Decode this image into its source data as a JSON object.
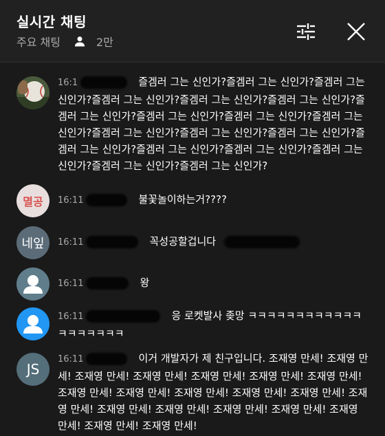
{
  "header": {
    "title": "실시간 채팅",
    "mode": "주요 채팅",
    "viewer_count": "2만"
  },
  "icons": {
    "viewer": "person-icon",
    "filter": "sliders-icon",
    "close": "close-icon"
  },
  "colors": {
    "header_bg": "#212121",
    "chat_bg": "#1a1a1a",
    "secondary_text": "#aaaaaa",
    "avatar_blue": "#2196f3",
    "avatar_gray": "#607d8b"
  },
  "messages": [
    {
      "time": "16:1",
      "avatar_text": "",
      "text": "즐겜러 그는 신인가?즐겜러 그는 신인가?즐겜러 그는 신인가?즐겜러 그는 신인가?즐겜러 그는 신인가?즐겜러 그는 신인가?즐겜러 그는 신인가?즐겜러 그는 신인가?즐겜러 그는 신인가?즐겜러 그는 신인가?즐겜러 그는 신인가?즐겜러 그는 신인가?즐겜러 그는 신인가?즐겜러 그는 신인가?즐겜러 그는 신인가?즐겜러 그는 신인가?즐겜러 그는 신인가?즐겜러 그는 신인가?즐겜러 그는 신인가?"
    },
    {
      "time": "16:11",
      "avatar_text": "멸공",
      "text": "불꽃놀이하는거????"
    },
    {
      "time": "16:11",
      "avatar_text": "네잎",
      "text": "꼭성공할겁니다"
    },
    {
      "time": "16:11",
      "avatar_text": "",
      "text": "왕"
    },
    {
      "time": "16:11",
      "avatar_text": "",
      "text": "응 로켓발사 좆망 ㅋㅋㅋㅋㅋㅋㅋㅋㅋㅋㅋㅋㅋㅋㅋㅋㅋㅋㅋ"
    },
    {
      "time": "16:11",
      "avatar_text": "JS",
      "text": "이거 개발자가 제 친구입니다. 조재영 만세! 조재영 만세! 조재영 만세! 조재영 만세! 조재영 만세! 조재영 만세! 조재영 만세! 조재영 만세! 조재영 만세! 조재영 만세! 조재영 만세! 조재영 만세! 조재영 만세! 조재영 만세! 조재영 만세! 조재영 만세! 조재영 만세! 조재영 만세! 조재영 만세! 조재영 만세!"
    }
  ]
}
